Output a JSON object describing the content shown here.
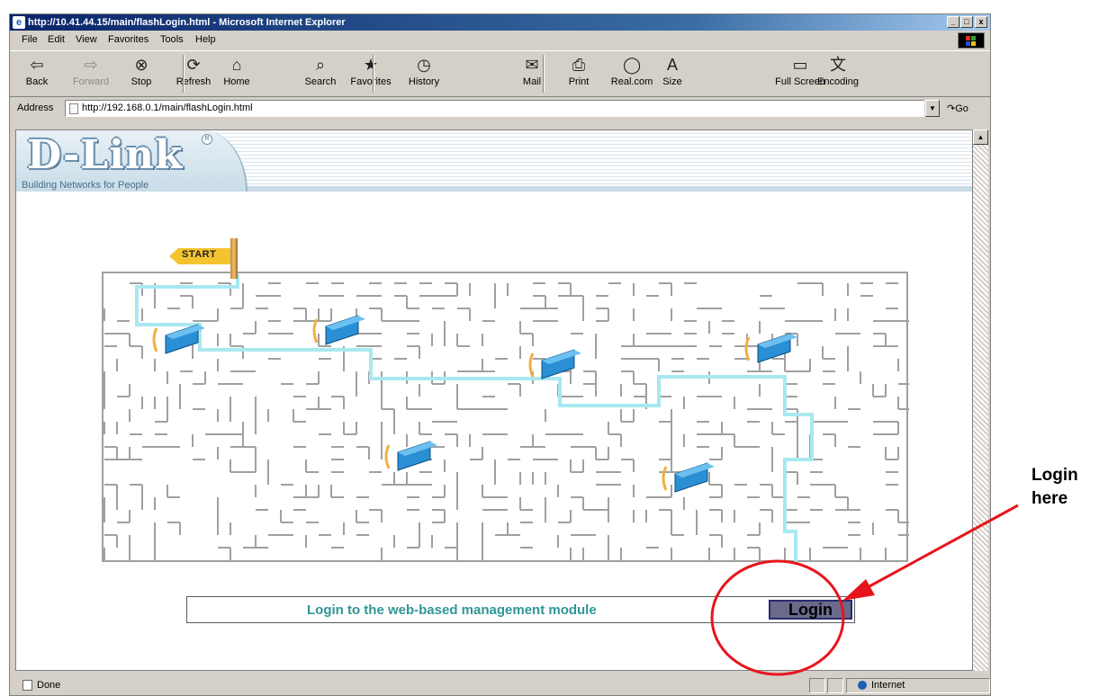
{
  "window": {
    "title": "http://10.41.44.15/main/flashLogin.html - Microsoft Internet Explorer",
    "minimize_glyph": "_",
    "restore_glyph": "□",
    "close_glyph": "x"
  },
  "menu": [
    "File",
    "Edit",
    "View",
    "Favorites",
    "Tools",
    "Help"
  ],
  "toolbar": [
    {
      "label": "Back",
      "icon": "back-arrow-icon",
      "glyph": "⇦",
      "enabled": true
    },
    {
      "label": "Forward",
      "icon": "forward-arrow-icon",
      "glyph": "⇨",
      "enabled": false
    },
    {
      "label": "Stop",
      "icon": "stop-icon",
      "glyph": "⊗",
      "enabled": true
    },
    {
      "label": "Refresh",
      "icon": "refresh-icon",
      "glyph": "⟳",
      "enabled": true
    },
    {
      "label": "Home",
      "icon": "home-icon",
      "glyph": "⌂",
      "enabled": true
    },
    {
      "label": "Search",
      "icon": "search-icon",
      "glyph": "⌕",
      "enabled": true
    },
    {
      "label": "Favorites",
      "icon": "favorites-icon",
      "glyph": "★",
      "enabled": true
    },
    {
      "label": "History",
      "icon": "history-icon",
      "glyph": "◷",
      "enabled": true
    },
    {
      "label": "Mail",
      "icon": "mail-icon",
      "glyph": "✉",
      "enabled": true
    },
    {
      "label": "Print",
      "icon": "print-icon",
      "glyph": "⎙",
      "enabled": true
    },
    {
      "label": "Real.com",
      "icon": "real-com-icon",
      "glyph": "◯",
      "enabled": true
    },
    {
      "label": "Size",
      "icon": "text-size-icon",
      "glyph": "A",
      "enabled": true
    },
    {
      "label": "Full Screen",
      "icon": "full-screen-icon",
      "glyph": "▭",
      "enabled": true
    },
    {
      "label": "Encoding",
      "icon": "encoding-icon",
      "glyph": "文",
      "enabled": true
    }
  ],
  "address": {
    "label": "Address",
    "url": "http://192.168.0.1/main/flashLogin.html",
    "go_label": "Go"
  },
  "page": {
    "logo_text": "D-Link",
    "logo_registered": "R",
    "tagline": "Building Networks for People",
    "start_sign": "START",
    "login_prompt": "Login to the web-based management module",
    "login_button": "Login"
  },
  "status": {
    "text": "Done",
    "zone": "Internet"
  },
  "annotation": {
    "line1": "Login",
    "line2": "here",
    "color": "#e8141c"
  },
  "colors": {
    "title_bar": "#0a246a",
    "login_text": "#2f9597",
    "maze_path": "#a8e8f0",
    "router_blue": "#2a8fd4"
  }
}
